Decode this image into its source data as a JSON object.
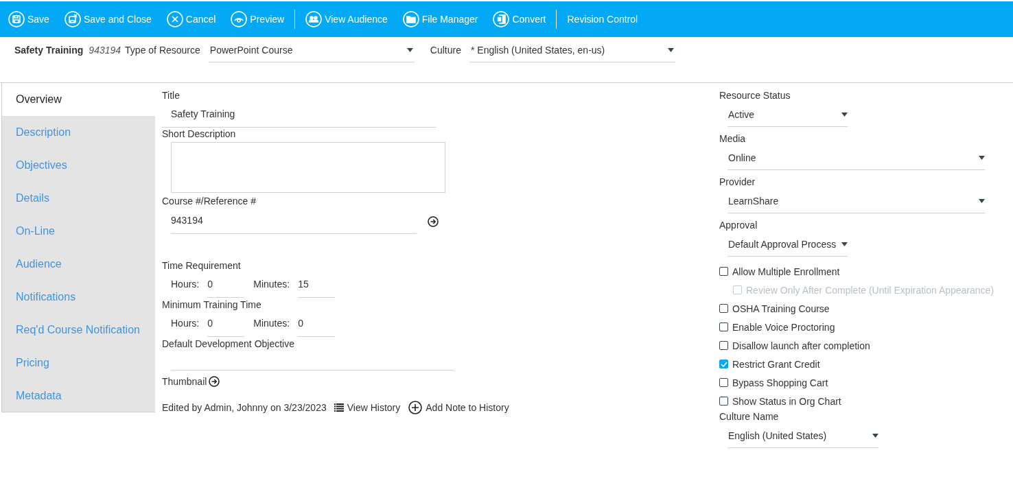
{
  "toolbar": [
    {
      "kind": "button",
      "label": "Save"
    },
    {
      "kind": "button",
      "label": "Save and Close"
    },
    {
      "kind": "button",
      "label": "Cancel"
    },
    {
      "kind": "button",
      "label": "Preview"
    },
    {
      "kind": "separator"
    },
    {
      "kind": "button",
      "label": "View Audience"
    },
    {
      "kind": "button",
      "label": "File Manager"
    },
    {
      "kind": "button",
      "label": "Convert"
    },
    {
      "kind": "separator"
    },
    {
      "kind": "button",
      "label": "Revision Control"
    }
  ],
  "header": {
    "title": "Safety Training",
    "id": "943194",
    "type_label": "Type of Resource",
    "type_value": "PowerPoint Course",
    "culture_label": "Culture",
    "culture_value": "* English (United States, en-us)"
  },
  "sidebar": {
    "items": [
      {
        "label": "Overview",
        "selected": true
      },
      {
        "label": "Description",
        "selected": false
      },
      {
        "label": "Objectives",
        "selected": false
      },
      {
        "label": "Details",
        "selected": false
      },
      {
        "label": "On-Line",
        "selected": false
      },
      {
        "label": "Audience",
        "selected": false
      },
      {
        "label": "Notifications",
        "selected": false
      },
      {
        "label": "Req'd Course Notification",
        "selected": false
      },
      {
        "label": "Pricing",
        "selected": false
      },
      {
        "label": "Metadata",
        "selected": false
      }
    ]
  },
  "overview": {
    "title": {
      "label": "Title",
      "value": "Safety Training"
    },
    "short_description": {
      "label": "Short Description"
    },
    "course_number": {
      "label": "Course #/Reference #",
      "value": "943194"
    },
    "time_requirement": {
      "label": "Time Requirement",
      "hours_label": "Hours:",
      "hours": "0",
      "minutes_label": "Minutes:",
      "minutes": "15"
    },
    "minimum_training_time": {
      "label": "Minimum Training Time",
      "hours_label": "Hours:",
      "hours": "0",
      "minutes_label": "Minutes:",
      "minutes": "0"
    },
    "default_development_objective": {
      "label": "Default Development Objective"
    },
    "thumbnail": {
      "label": "Thumbnail"
    },
    "footer": {
      "edited": "Edited by Admin, Johnny on 3/23/2023",
      "view_history": "View History",
      "add_note": "Add Note to History"
    }
  },
  "settings": [
    {
      "kind": "select",
      "label": "Resource Status",
      "value": "Active"
    },
    {
      "kind": "select",
      "label": "Media",
      "value": "Online"
    },
    {
      "kind": "select",
      "label": "Provider",
      "value": "LearnShare"
    },
    {
      "kind": "select",
      "label": "Approval",
      "value": "Default Approval Process"
    },
    {
      "kind": "checkbox",
      "label": "Allow Multiple Enrollment",
      "checked": false,
      "disabled": false,
      "children": [
        {
          "kind": "checkbox",
          "label": "Review Only After Complete (Until Expiration Appearance)",
          "checked": false,
          "disabled": true
        }
      ]
    },
    {
      "kind": "checkbox",
      "label": "OSHA Training Course",
      "checked": false,
      "disabled": false
    },
    {
      "kind": "checkbox",
      "label": "Enable Voice Proctoring",
      "checked": false,
      "disabled": false
    },
    {
      "kind": "checkbox",
      "label": "Disallow launch after completion",
      "checked": false,
      "disabled": false
    },
    {
      "kind": "checkbox",
      "label": "Restrict Grant Credit",
      "checked": true,
      "disabled": false
    },
    {
      "kind": "checkbox",
      "label": "Bypass Shopping Cart",
      "checked": false,
      "disabled": false
    },
    {
      "kind": "checkbox",
      "label": "Show Status in Org Chart",
      "checked": false,
      "disabled": false
    },
    {
      "kind": "select",
      "label": "Culture Name",
      "value": "English (United States)"
    }
  ]
}
